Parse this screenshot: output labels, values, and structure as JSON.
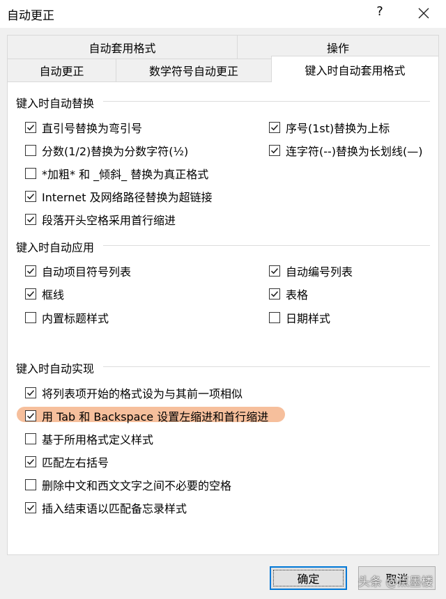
{
  "dialog": {
    "title": "自动更正",
    "help_label": "?"
  },
  "tabs_row1": [
    "自动套用格式",
    "操作"
  ],
  "tabs_row2": [
    "自动更正",
    "数学符号自动更正",
    "键入时自动套用格式"
  ],
  "section_replace": {
    "title": "键入时自动替换",
    "items": [
      {
        "label": "直引号替换为弯引号",
        "checked": true
      },
      {
        "label": "序号(1st)替换为上标",
        "checked": true
      },
      {
        "label": "分数(1/2)替换为分数字符(½)",
        "checked": false
      },
      {
        "label": "连字符(--)替换为长划线(—)",
        "checked": true
      },
      {
        "label": "*加粗* 和 _倾斜_ 替换为真正格式",
        "checked": false
      },
      {
        "label": "Internet 及网络路径替换为超链接",
        "checked": true
      },
      {
        "label": "段落开头空格采用首行缩进",
        "checked": true
      }
    ]
  },
  "section_apply": {
    "title": "键入时自动应用",
    "items": [
      {
        "label": "自动项目符号列表",
        "checked": true
      },
      {
        "label": "自动编号列表",
        "checked": true
      },
      {
        "label": "框线",
        "checked": true
      },
      {
        "label": "表格",
        "checked": true
      },
      {
        "label": "内置标题样式",
        "checked": false
      },
      {
        "label": "日期样式",
        "checked": false
      }
    ]
  },
  "section_implement": {
    "title": "键入时自动实现",
    "items": [
      {
        "label": "将列表项开始的格式设为与其前一项相似",
        "checked": true
      },
      {
        "label": "用 Tab 和 Backspace 设置左缩进和首行缩进",
        "checked": true
      },
      {
        "label": "基于所用格式定义样式",
        "checked": false
      },
      {
        "label": "匹配左右括号",
        "checked": true
      },
      {
        "label": "删除中文和西文文字之间不必要的空格",
        "checked": false
      },
      {
        "label": "插入结束语以匹配备忘录样式",
        "checked": true
      }
    ]
  },
  "buttons": {
    "ok": "确定",
    "cancel": "取消"
  },
  "watermark": "头条 @点墨楼",
  "colors": {
    "highlight": "#f6bf9c",
    "default_button_border": "#0078d7"
  }
}
